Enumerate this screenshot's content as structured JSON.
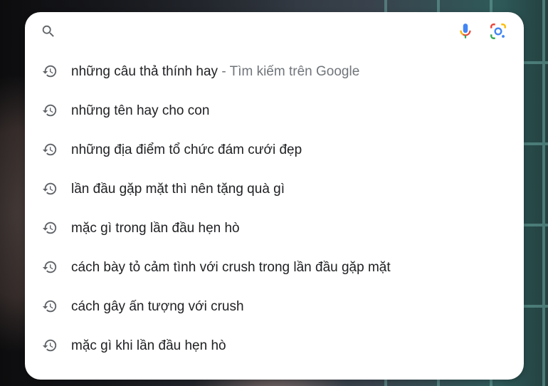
{
  "search": {
    "value": "",
    "placeholder": "",
    "icons": {
      "search": "search-icon",
      "voice": "microphone-icon",
      "lens": "google-lens-icon"
    }
  },
  "suggestions": [
    {
      "text": "những câu thả thính hay",
      "suffix": " - Tìm kiếm trên Google",
      "icon": "history-icon"
    },
    {
      "text": "những tên hay cho con",
      "suffix": "",
      "icon": "history-icon"
    },
    {
      "text": "những địa điểm tổ chức đám cưới đẹp",
      "suffix": "",
      "icon": "history-icon"
    },
    {
      "text": "lần đầu gặp mặt thì nên tặng quà gì",
      "suffix": "",
      "icon": "history-icon"
    },
    {
      "text": "mặc gì trong lần đầu hẹn hò",
      "suffix": "",
      "icon": "history-icon"
    },
    {
      "text": "cách bày tỏ cảm tình với crush trong lần đầu gặp mặt",
      "suffix": "",
      "icon": "history-icon"
    },
    {
      "text": "cách gây ấn tượng với crush",
      "suffix": "",
      "icon": "history-icon"
    },
    {
      "text": "mặc gì khi lần đầu hẹn hò",
      "suffix": "",
      "icon": "history-icon"
    }
  ],
  "colors": {
    "google_blue": "#4285F4",
    "google_red": "#EA4335",
    "google_yellow": "#FBBC05",
    "google_green": "#34A853",
    "icon_gray": "#5f6368"
  }
}
